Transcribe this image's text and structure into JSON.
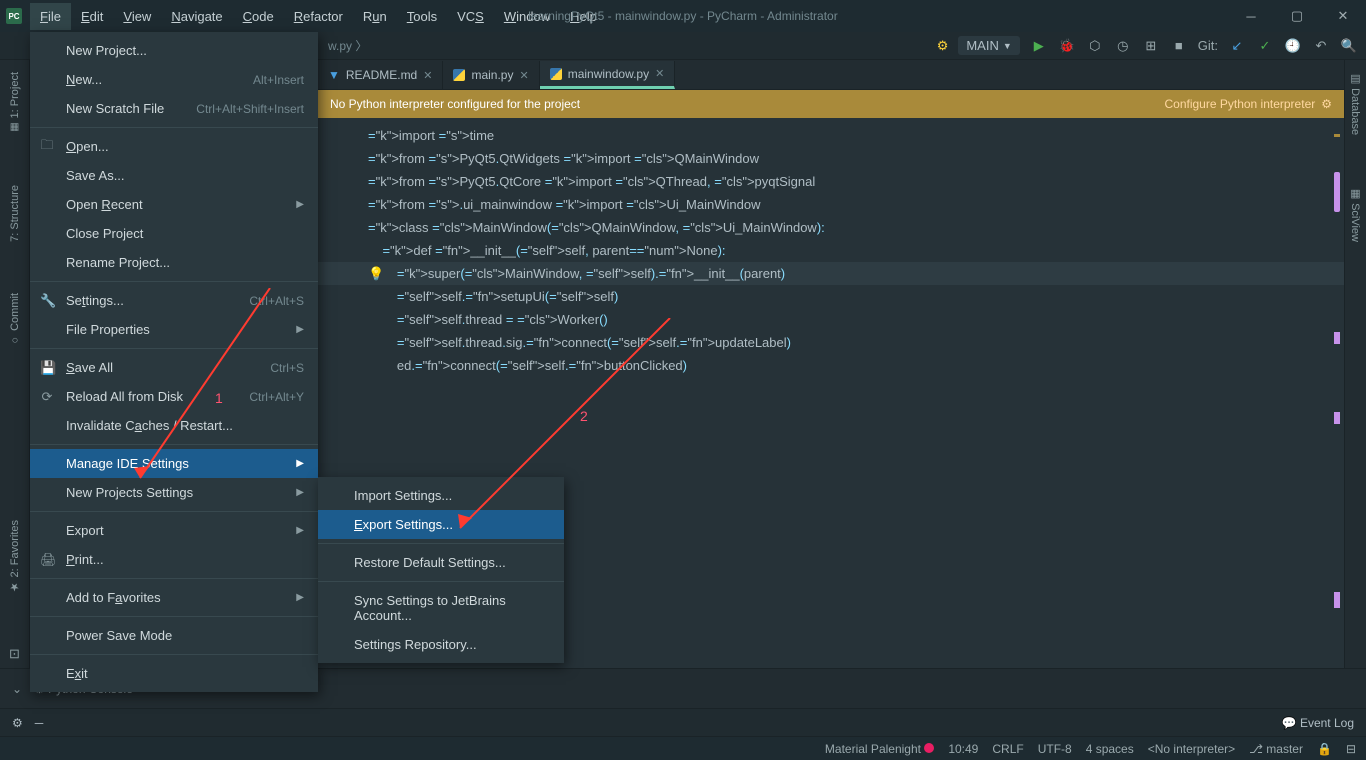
{
  "title": "learningPyQt5 - mainwindow.py - PyCharm - Administrator",
  "app_icon_label": "PC",
  "menubar": {
    "items": [
      "File",
      "Edit",
      "View",
      "Navigate",
      "Code",
      "Refactor",
      "Run",
      "Tools",
      "VCS",
      "Window",
      "Help"
    ]
  },
  "breadcrumb": "w.py 〉",
  "run_config": "MAIN",
  "git_label": "Git:",
  "left_tabs": {
    "project": "1: Project",
    "structure": "7: Structure",
    "commit": "Commit",
    "favorites": "2: Favorites"
  },
  "right_tabs": {
    "database": "Database",
    "sciview": "SciView"
  },
  "file_menu": {
    "new_project": "New Project...",
    "new": "New...",
    "new_sc": "Alt+Insert",
    "scratch": "New Scratch File",
    "scratch_sc": "Ctrl+Alt+Shift+Insert",
    "open": "Open...",
    "save_as": "Save As...",
    "open_recent": "Open Recent",
    "close_proj": "Close Project",
    "rename_proj": "Rename Project...",
    "settings": "Settings...",
    "settings_sc": "Ctrl+Alt+S",
    "file_props": "File Properties",
    "save_all": "Save All",
    "save_all_sc": "Ctrl+S",
    "reload": "Reload All from Disk",
    "reload_sc": "Ctrl+Alt+Y",
    "invalidate": "Invalidate Caches / Restart...",
    "manage_ide": "Manage IDE Settings",
    "new_proj_set": "New Projects Settings",
    "export": "Export",
    "print": "Print...",
    "add_fav": "Add to Favorites",
    "power_save": "Power Save Mode",
    "exit": "Exit"
  },
  "sub_menu": {
    "import": "Import Settings...",
    "export": "Export Settings...",
    "restore": "Restore Default Settings...",
    "sync": "Sync Settings to JetBrains Account...",
    "repo": "Settings Repository..."
  },
  "tabs": {
    "readme": "README.md",
    "main": "main.py",
    "mainwindow": "mainwindow.py"
  },
  "warn": {
    "msg": "No Python interpreter configured for the project",
    "action": "Configure Python interpreter"
  },
  "terminal": {
    "python_console": "Python Console"
  },
  "toolwin": {
    "event_log": "Event Log"
  },
  "status": {
    "theme": "Material Palenight",
    "time": "10:49",
    "le": "CRLF",
    "enc": "UTF-8",
    "indent": "4 spaces",
    "interp": "<No interpreter>",
    "branch": "master"
  },
  "annotations": {
    "a1": "1",
    "a2": "2"
  },
  "code": [
    {
      "g": "",
      "t": "import time",
      "cls": ""
    },
    {
      "g": "",
      "t": "",
      "cls": ""
    },
    {
      "g": "",
      "t": "from PyQt5.QtWidgets import QMainWindow",
      "cls": ""
    },
    {
      "g": "",
      "t": "from PyQt5.QtCore import QThread, pyqtSignal",
      "cls": ""
    },
    {
      "g": "",
      "t": "from .ui_mainwindow import Ui_MainWindow",
      "cls": ""
    },
    {
      "g": "",
      "t": "",
      "cls": ""
    },
    {
      "g": "",
      "t": "",
      "cls": ""
    },
    {
      "g": "",
      "t": "class MainWindow(QMainWindow, Ui_MainWindow):",
      "cls": ""
    },
    {
      "g": "",
      "t": "    def __init__(self, parent=None):",
      "cls": ""
    },
    {
      "g": "",
      "t": "        super(MainWindow, self).__init__(parent)",
      "cls": "hl",
      "bulb": true
    },
    {
      "g": "",
      "t": "        self.setupUi(self)",
      "cls": ""
    },
    {
      "g": "",
      "t": "",
      "cls": ""
    },
    {
      "g": "",
      "t": "        self.thread = Worker()",
      "cls": ""
    },
    {
      "g": "",
      "t": "        self.thread.sig.connect(self.updateLabel)",
      "cls": ""
    },
    {
      "g": "",
      "t": "",
      "cls": ""
    },
    {
      "g": "",
      "t": "        ed.connect(self.buttonClicked)",
      "cls": ""
    }
  ]
}
